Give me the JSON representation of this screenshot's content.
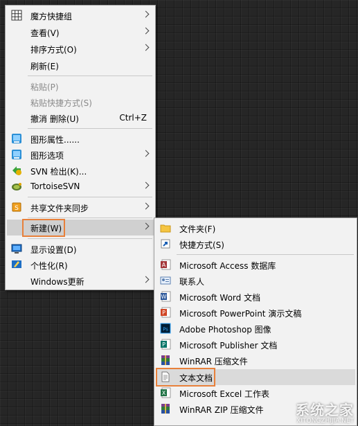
{
  "context_menu": {
    "items": [
      {
        "label": "魔方快捷组",
        "icon": "grid-icon",
        "has_submenu": true
      },
      {
        "label": "查看(V)",
        "has_submenu": true
      },
      {
        "label": "排序方式(O)",
        "has_submenu": true
      },
      {
        "label": "刷新(E)"
      },
      {
        "label": "粘贴(P)",
        "disabled": true
      },
      {
        "label": "粘贴快捷方式(S)",
        "disabled": true
      },
      {
        "label": "撤消 删除(U)",
        "shortcut": "Ctrl+Z"
      },
      {
        "label": "图形属性......",
        "icon": "graphics-icon"
      },
      {
        "label": "图形选项",
        "icon": "graphics-icon",
        "has_submenu": true
      },
      {
        "label": "SVN 检出(K)...",
        "icon": "svn-checkout-icon"
      },
      {
        "label": "TortoiseSVN",
        "icon": "tortoise-icon",
        "has_submenu": true
      },
      {
        "label": "共享文件夹同步",
        "icon": "sync-icon",
        "has_submenu": true
      },
      {
        "label": "新建(W)",
        "has_submenu": true,
        "active": true
      },
      {
        "label": "显示设置(D)",
        "icon": "display-icon"
      },
      {
        "label": "个性化(R)",
        "icon": "personalize-icon"
      },
      {
        "label": "Windows更新",
        "has_submenu": true
      }
    ]
  },
  "new_submenu": {
    "items": [
      {
        "label": "文件夹(F)",
        "icon": "folder-icon"
      },
      {
        "label": "快捷方式(S)",
        "icon": "shortcut-icon"
      },
      {
        "label": "Microsoft Access 数据库",
        "icon": "access-icon"
      },
      {
        "label": "联系人",
        "icon": "contact-icon"
      },
      {
        "label": "Microsoft Word 文档",
        "icon": "word-icon"
      },
      {
        "label": "Microsoft PowerPoint 演示文稿",
        "icon": "powerpoint-icon"
      },
      {
        "label": "Adobe Photoshop 图像",
        "icon": "photoshop-icon"
      },
      {
        "label": "Microsoft Publisher 文档",
        "icon": "publisher-icon"
      },
      {
        "label": "WinRAR 压缩文件",
        "icon": "winrar-icon"
      },
      {
        "label": "文本文档",
        "icon": "text-document-icon",
        "selected": true
      },
      {
        "label": "Microsoft Excel 工作表",
        "icon": "excel-icon"
      },
      {
        "label": "WinRAR ZIP 压缩文件",
        "icon": "winrar-zip-icon"
      }
    ]
  },
  "watermark": {
    "text": "系统之家",
    "sub": "XITONGZHIJIA.NET"
  },
  "colors": {
    "highlight_border": "#e8803a",
    "menu_bg": "#f2f2f2"
  }
}
